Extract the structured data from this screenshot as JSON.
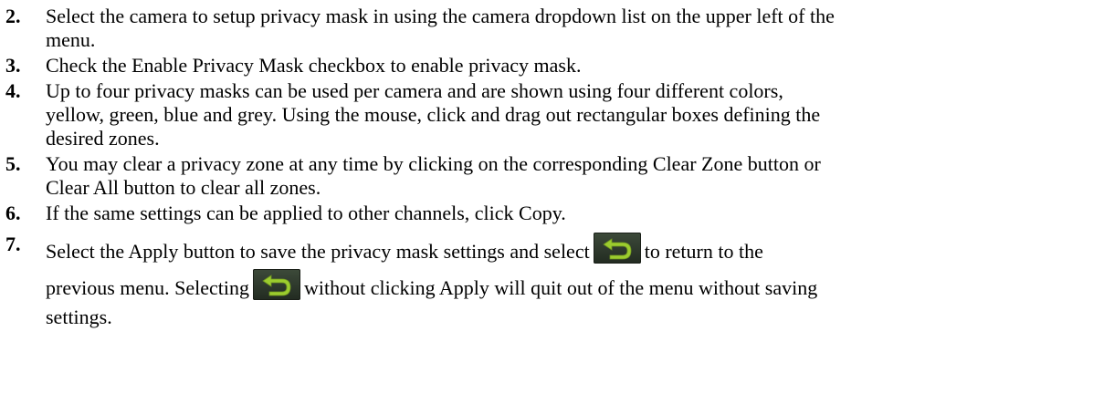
{
  "steps": [
    {
      "number": "2.",
      "lines": [
        "Select the camera to setup privacy mask in using the camera dropdown list on the upper left of the",
        "menu."
      ]
    },
    {
      "number": "3.",
      "lines": [
        "Check the Enable Privacy Mask checkbox to enable privacy mask."
      ]
    },
    {
      "number": "4.",
      "lines": [
        "Up to four privacy masks can be used per camera and are shown using four different colors,",
        "yellow, green, blue and grey. Using the mouse, click and drag out rectangular boxes defining the",
        "desired zones."
      ]
    },
    {
      "number": "5.",
      "lines": [
        "You may clear a privacy zone at any time by clicking on the corresponding Clear Zone button or",
        "Clear All button to clear all zones."
      ]
    },
    {
      "number": "6.",
      "lines": [
        "If the same settings can be applied to other channels, click Copy."
      ]
    },
    {
      "number": "7.",
      "line1_before_icon": "Select the Apply button to save the privacy mask settings and select",
      "line1_after_icon": "to return to the",
      "line2_before_icon": "previous menu. Selecting",
      "line2_after_icon": "without clicking Apply will quit out of the menu without saving",
      "line3": "settings."
    }
  ],
  "icons": {
    "return": "return-arrow-icon",
    "return_bg": "#2c3629",
    "return_arrow": "#9ccc2e"
  }
}
